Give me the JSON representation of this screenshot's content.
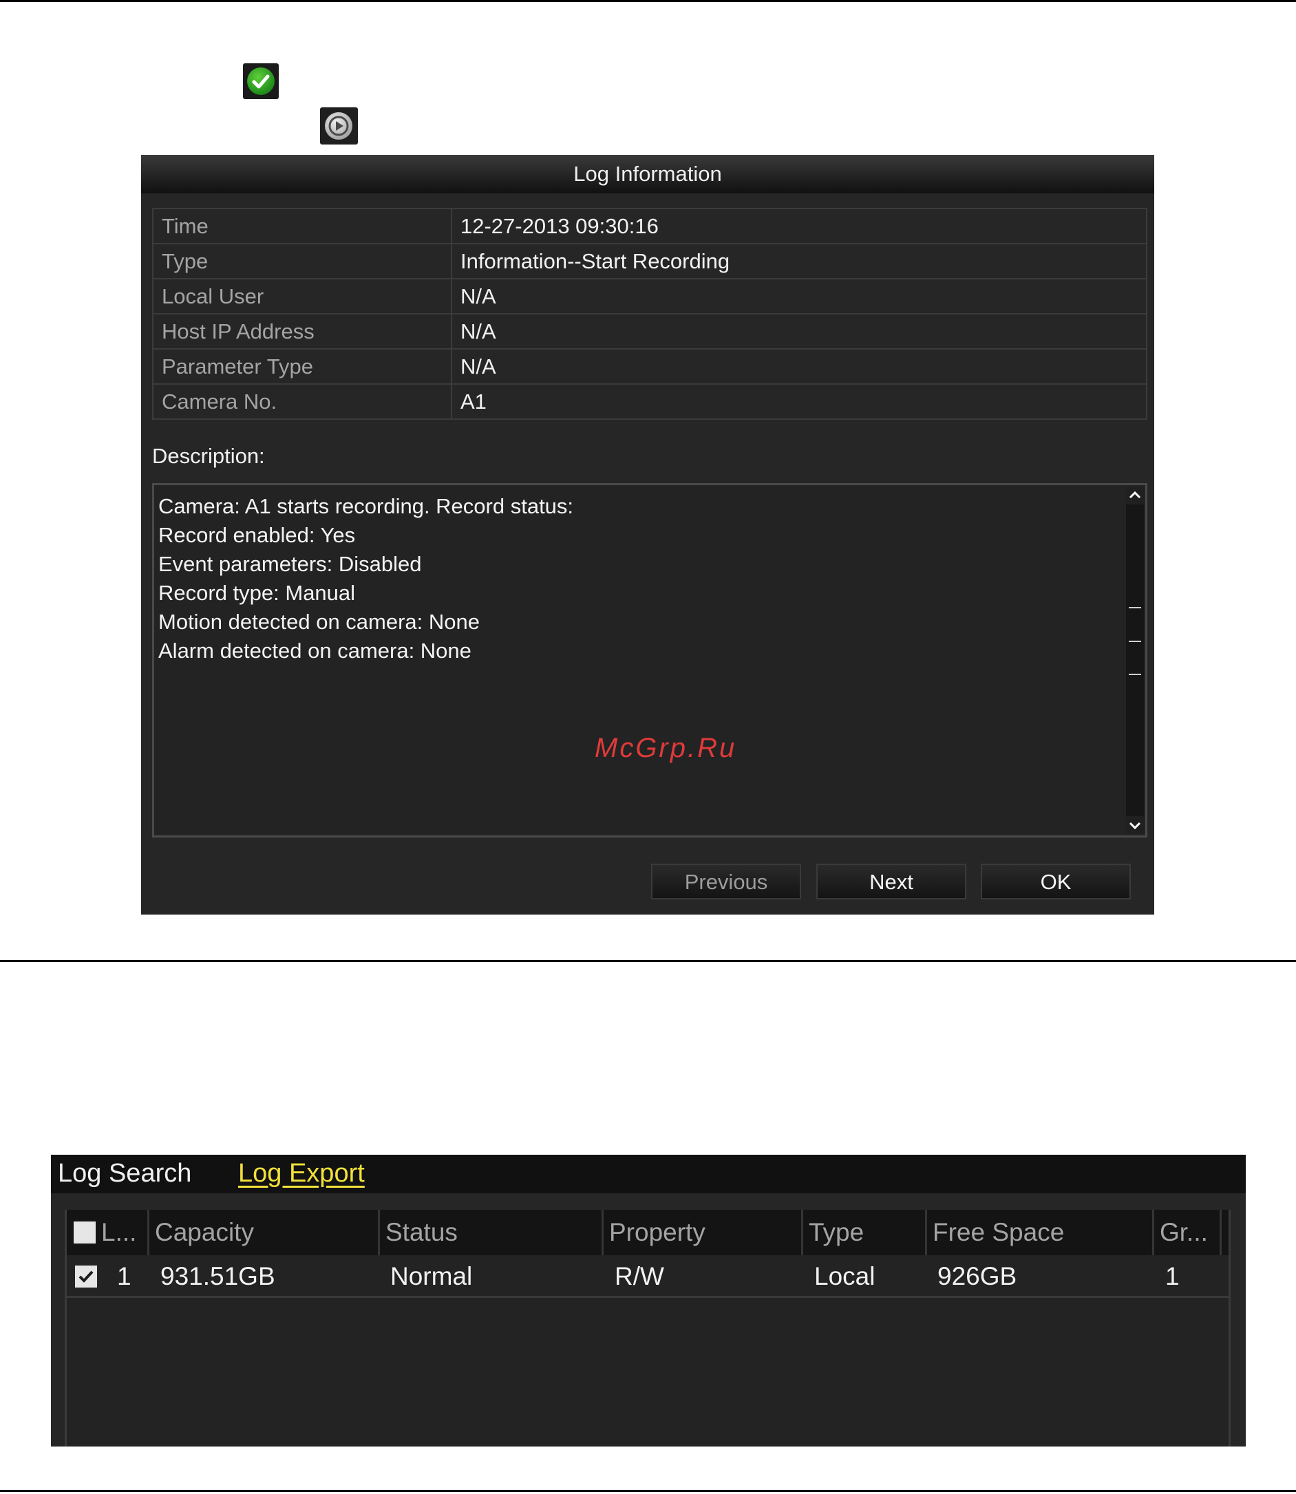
{
  "dialog": {
    "title": "Log Information",
    "fields": [
      {
        "label": "Time",
        "value": "12-27-2013 09:30:16"
      },
      {
        "label": "Type",
        "value": "Information--Start Recording"
      },
      {
        "label": "Local User",
        "value": "N/A"
      },
      {
        "label": "Host IP Address",
        "value": "N/A"
      },
      {
        "label": "Parameter Type",
        "value": "N/A"
      },
      {
        "label": "Camera No.",
        "value": "A1"
      }
    ],
    "description_label": "Description:",
    "description_lines": [
      "Camera: A1 starts recording. Record status:",
      "Record enabled: Yes",
      "Event parameters: Disabled",
      "Record type: Manual",
      "Motion detected on camera: None",
      "Alarm detected on camera: None"
    ],
    "watermark": "McGrp.Ru",
    "buttons": {
      "previous": "Previous",
      "next": "Next",
      "ok": "OK"
    }
  },
  "icons": {
    "top": "check-icon",
    "second": "play-icon"
  },
  "export_panel": {
    "tabs": [
      {
        "label": "Log Search",
        "active": false
      },
      {
        "label": "Log Export",
        "active": true
      }
    ],
    "columns": [
      "L...",
      "Capacity",
      "Status",
      "Property",
      "Type",
      "Free Space",
      "Gr..."
    ],
    "rows": [
      {
        "checked": true,
        "label": "1",
        "capacity": "931.51GB",
        "status": "Normal",
        "property": "R/W",
        "type": "Local",
        "free_space": "926GB",
        "group": "1"
      }
    ]
  },
  "colors": {
    "active_tab": "#f2e13a",
    "watermark": "#e03a3a",
    "panel_bg": "#262626"
  }
}
